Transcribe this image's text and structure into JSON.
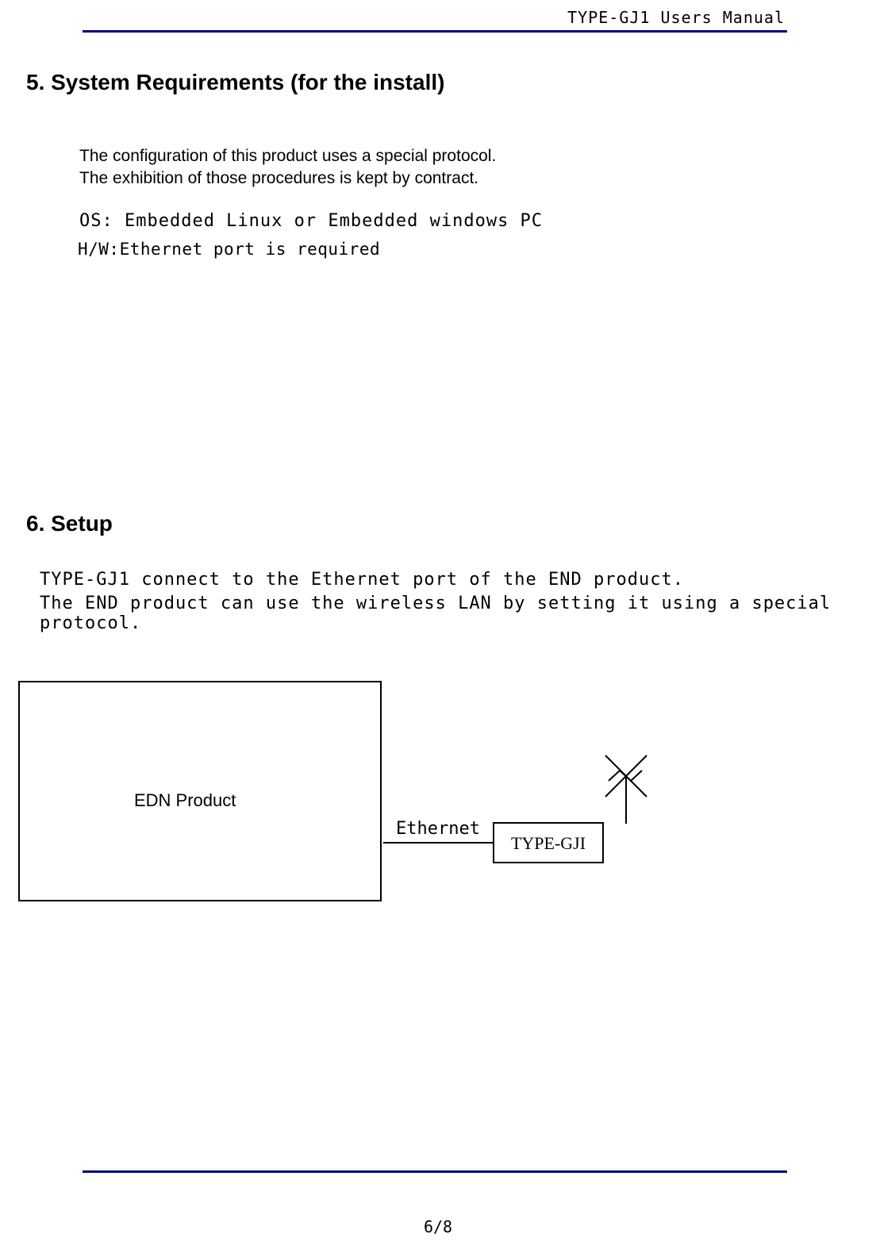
{
  "header": {
    "doc_title": "TYPE-GJ1 Users Manual"
  },
  "section5": {
    "heading": "5. System Requirements (for the install)",
    "para_line1": "The configuration of this product uses a special protocol.",
    "para_line2": "The exhibition of those procedures is kept by contract.",
    "os_line": "OS: Embedded Linux or Embedded windows PC",
    "hw_line": "H/W:Ethernet port is required"
  },
  "section6": {
    "heading": "6. Setup",
    "para_line1": "TYPE-GJ1 connect to the Ethernet port of the END product.",
    "para_line2": "The END product can use the wireless LAN by setting it using a special protocol."
  },
  "diagram": {
    "edn_label": "EDN Product",
    "ethernet_label": "Ethernet",
    "gji_label": "TYPE-GJI"
  },
  "footer": {
    "page": "6/8"
  }
}
